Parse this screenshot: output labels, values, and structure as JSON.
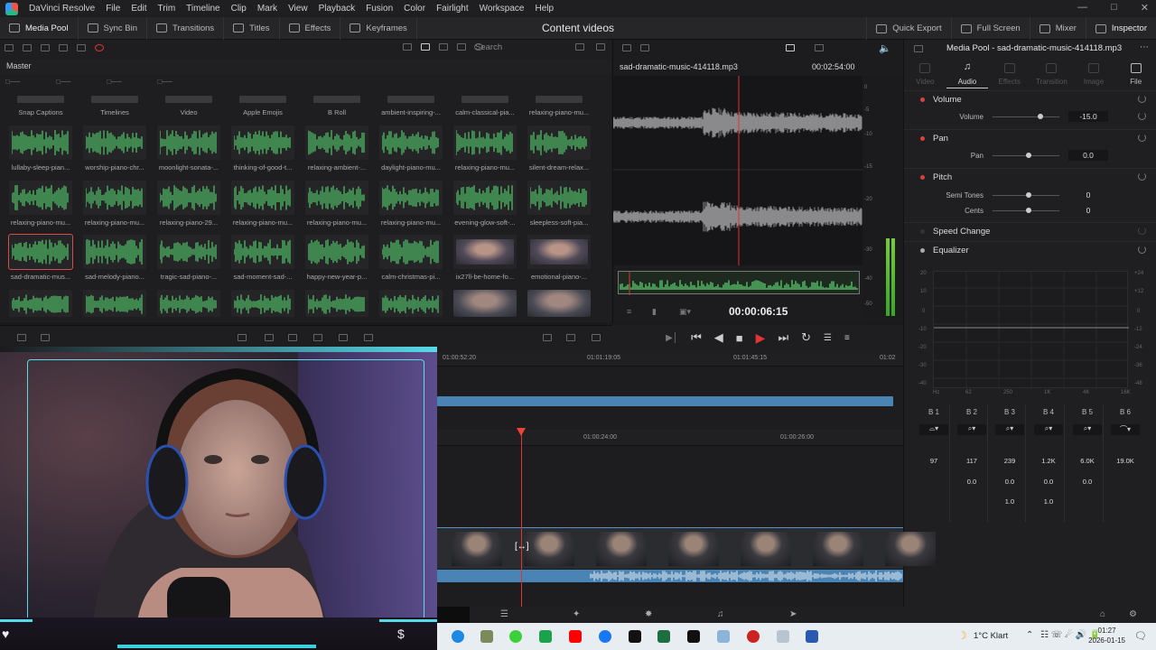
{
  "menubar": {
    "app_title": "DaVinci Resolve",
    "items": [
      "File",
      "Edit",
      "Trim",
      "Timeline",
      "Clip",
      "Mark",
      "View",
      "Playback",
      "Fusion",
      "Color",
      "Fairlight",
      "Workspace",
      "Help"
    ]
  },
  "toolbar": {
    "media_pool": "Media Pool",
    "sync_bin": "Sync Bin",
    "transitions": "Transitions",
    "titles": "Titles",
    "effects": "Effects",
    "keyframes": "Keyframes",
    "project_title": "Content videos",
    "quick_export": "Quick Export",
    "full_screen": "Full Screen",
    "mixer": "Mixer",
    "inspector": "Inspector"
  },
  "media_pool": {
    "search_placeholder": "Search",
    "bin": "Master",
    "folders": [
      "Snap Captions",
      "Timelines",
      "Video",
      "Apple Emojis",
      "B Roll",
      "ambient-inspiring-...",
      "calm-classical-pia...",
      "relaxing-piano-mu..."
    ],
    "row1": [
      "lullaby-sleep-pian...",
      "worship-piano-chr...",
      "moonlight-sonata-...",
      "thinking-of-good-t...",
      "relaxing-ambient-...",
      "daylight-piano-mu...",
      "relaxing-piano-mu...",
      "silent-dream-relax..."
    ],
    "row2": [
      "relaxing-piano-mu...",
      "relaxing-piano-mu...",
      "relaxing-piano-29...",
      "relaxing-piano-mu...",
      "relaxing-piano-mu...",
      "relaxing-piano-mu...",
      "evening-glow-soft-...",
      "sleepless-soft-pia..."
    ],
    "row3": [
      "sad-dramatic-mus...",
      "sad-melody-piano...",
      "tragic-sad-piano-...",
      "sad-moment-sad-...",
      "happy-new-year-p...",
      "calm-christmas-pi...",
      "ix27ll-be-home-fo...",
      "emotional-piano-..."
    ]
  },
  "viewer": {
    "clip_name": "sad-dramatic-music-414118.mp3",
    "duration": "00:02:54:00",
    "timecode": "00:00:06:15",
    "meter_labels": [
      "0",
      "-5",
      "-10",
      "-15",
      "-20",
      "-30",
      "-40",
      "-50"
    ]
  },
  "inspector": {
    "title": "Media Pool - sad-dramatic-music-414118.mp3",
    "tabs": [
      "Video",
      "Audio",
      "Effects",
      "Transition",
      "Image",
      "File"
    ],
    "volume": {
      "section": "Volume",
      "label": "Volume",
      "value": "-15.0"
    },
    "pan": {
      "section": "Pan",
      "label": "Pan",
      "value": "0.0"
    },
    "pitch": {
      "section": "Pitch",
      "semi_label": "Semi Tones",
      "semi_value": "0",
      "cents_label": "Cents",
      "cents_value": "0"
    },
    "speed_change": "Speed Change",
    "equalizer": "Equalizer",
    "eq_y_labels": [
      "+24",
      "+12",
      "0",
      "-12",
      "-24",
      "-36",
      "-48"
    ],
    "eq_y_labels_left": [
      "20",
      "10",
      "0",
      "-10",
      "-20",
      "-30",
      "-40"
    ],
    "eq_x_labels": [
      "Hz",
      "62",
      "250",
      "1K",
      "4K",
      "16K"
    ],
    "bands": [
      "B 1",
      "B 2",
      "B 3",
      "B 4",
      "B 5",
      "B 6"
    ],
    "band_freq": [
      "97",
      "117",
      "239",
      "1.2K",
      "6.0K",
      "19.0K"
    ],
    "band_gain": [
      "0.0",
      "0.0",
      "0.0",
      "0.0"
    ],
    "band_q": [
      "1.0",
      "1.0"
    ]
  },
  "timeline": {
    "ruler_top": [
      "01:00:52:20",
      "01:01:19:05",
      "01:01:45:15",
      "01:02"
    ],
    "ruler_main": [
      "01:00:24:00",
      "01:00:26:00"
    ]
  },
  "taskbar": {
    "weather": "1°C  Klart",
    "time": "01:27",
    "date": "2026-01-15"
  }
}
